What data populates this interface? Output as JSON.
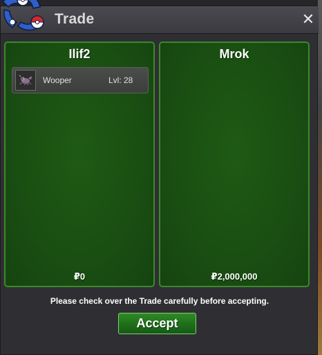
{
  "window": {
    "title": "Trade",
    "close_symbol": "✕"
  },
  "left_panel": {
    "player_name": "Ilif2",
    "items": [
      {
        "name": "Wooper",
        "level": "Lvl: 28",
        "icon": "wooper-sprite-icon"
      }
    ],
    "money": "₽0"
  },
  "right_panel": {
    "player_name": "Mrok",
    "items": [],
    "money": "₽2,000,000"
  },
  "footer": {
    "notice": "Please check over the Trade carefully before accepting.",
    "accept_label": "Accept"
  },
  "colors": {
    "panel_green": "#1a4f12",
    "panel_border": "#3b8a2a",
    "button_green": "#2f8a26",
    "window_bg": "#2f2f33"
  }
}
